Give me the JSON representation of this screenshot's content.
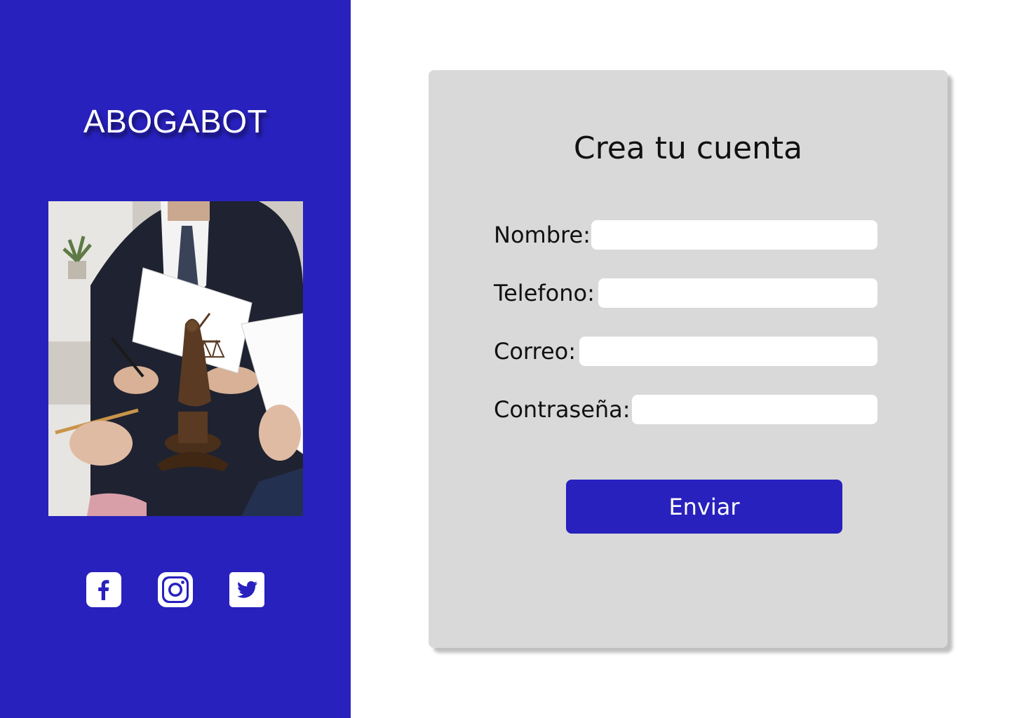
{
  "brand": {
    "name": "ABOGABOT"
  },
  "hero": {
    "alt": "Abogado revisando documentos con estatua de la justicia"
  },
  "social": [
    {
      "icon": "facebook-icon"
    },
    {
      "icon": "instagram-icon"
    },
    {
      "icon": "twitter-icon"
    }
  ],
  "form": {
    "title": "Crea tu cuenta",
    "fields": [
      {
        "label": "Nombre:",
        "value": ""
      },
      {
        "label": "Telefono:",
        "value": ""
      },
      {
        "label": "Correo:",
        "value": ""
      },
      {
        "label": "Contraseña:",
        "value": ""
      }
    ],
    "submit_label": "Enviar"
  },
  "colors": {
    "brand_blue": "#2821bd",
    "card_gray": "#d9d9d9",
    "input_bg": "#ffffff"
  }
}
